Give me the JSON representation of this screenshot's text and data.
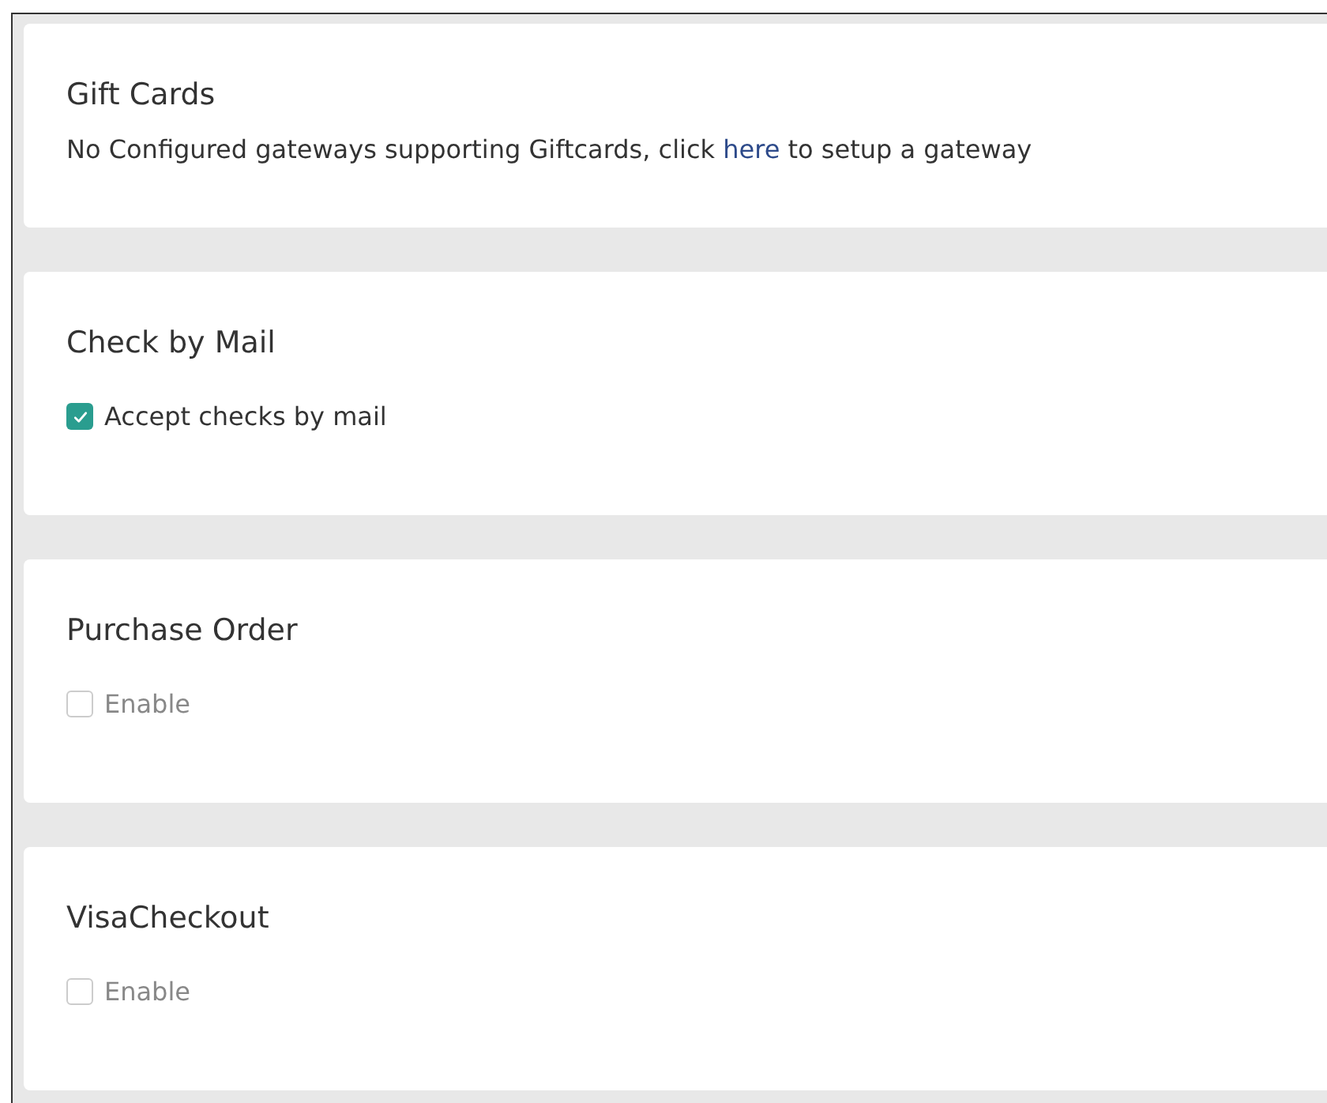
{
  "sections": [
    {
      "kind": "message",
      "title": "Gift Cards",
      "message_before": "No Configured gateways supporting Giftcards, click",
      "link": "here",
      "message_after": "to setup a gateway"
    },
    {
      "kind": "checkbox",
      "title": "Check by Mail",
      "option": {
        "label": "Accept checks by mail",
        "checked": true
      }
    },
    {
      "kind": "checkbox",
      "title": "Purchase Order",
      "option": {
        "label": "Enable",
        "checked": false
      }
    },
    {
      "kind": "checkbox",
      "title": "VisaCheckout",
      "option": {
        "label": "Enable",
        "checked": false
      }
    }
  ]
}
